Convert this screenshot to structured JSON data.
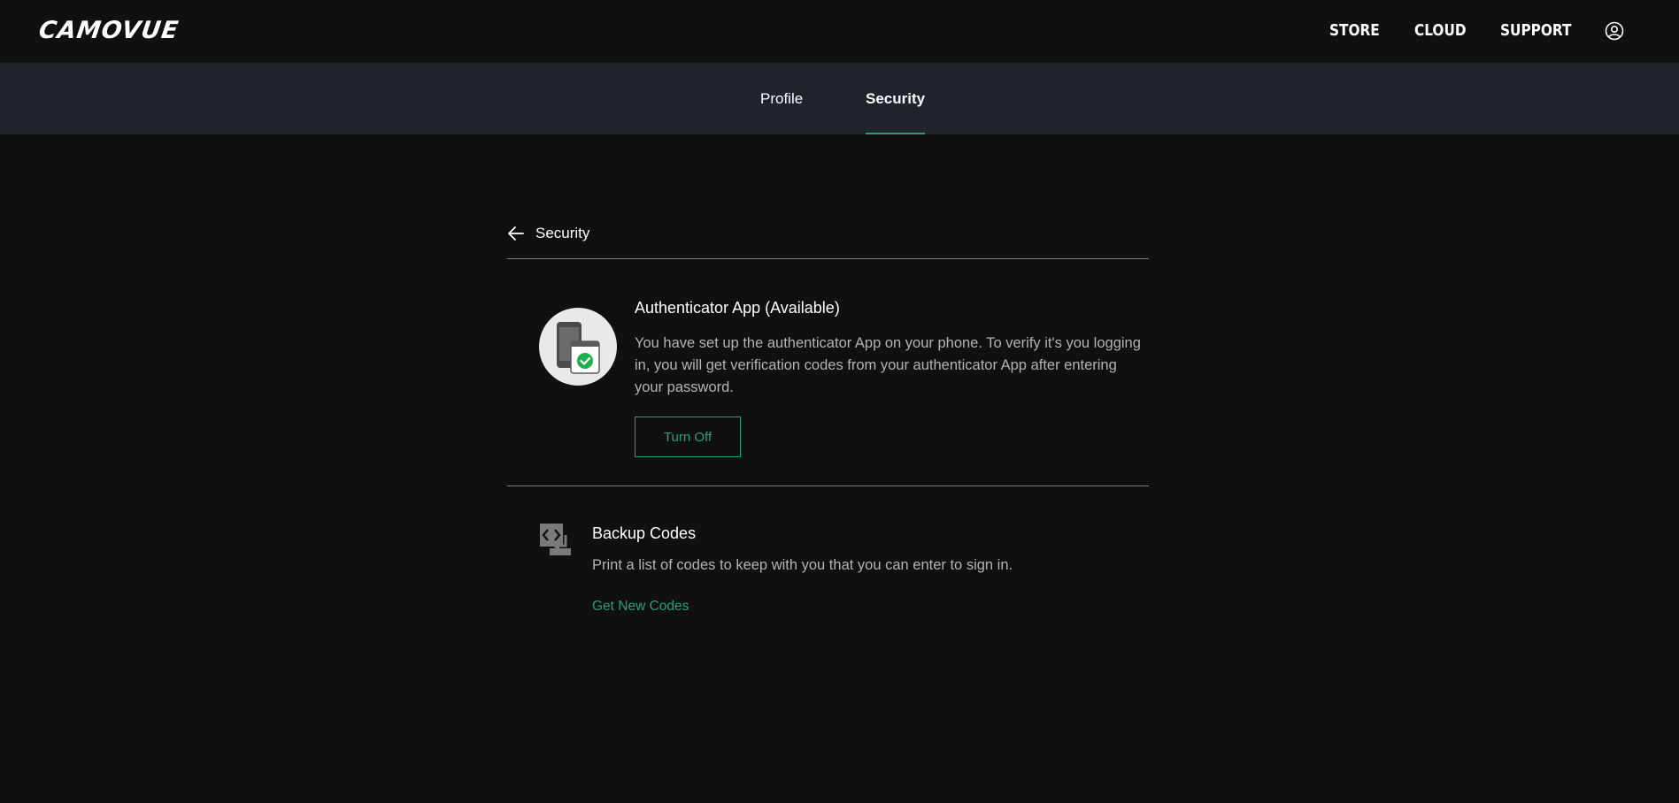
{
  "header": {
    "logo_text": "CAMOVUE",
    "nav": [
      {
        "label": "STORE"
      },
      {
        "label": "CLOUD"
      },
      {
        "label": "SUPPORT"
      }
    ],
    "account_icon": "user-circle-icon"
  },
  "subnav": {
    "tabs": [
      {
        "label": "Profile",
        "active": false
      },
      {
        "label": "Security",
        "active": true
      }
    ],
    "accent_color": "#2a9c83"
  },
  "page": {
    "back_icon": "arrow-left-icon",
    "title": "Security"
  },
  "authenticator": {
    "icon": "phone-check-icon",
    "title": "Authenticator App (Available)",
    "description": "You have set up the authenticator App on your phone. To verify it's you logging in, you will get verification codes from your authenticator App after entering your password.",
    "button_label": "Turn Off"
  },
  "backup": {
    "icon": "code-swap-icon",
    "title": "Backup Codes",
    "description": "Print a list of codes to keep with you that you can enter to sign in.",
    "link_label": "Get New Codes"
  },
  "colors": {
    "background": "#101010",
    "subnav_background": "#20232b",
    "accent": "#2a9c83",
    "muted_text": "#b3b3b3",
    "success_green": "#1fb14f"
  }
}
